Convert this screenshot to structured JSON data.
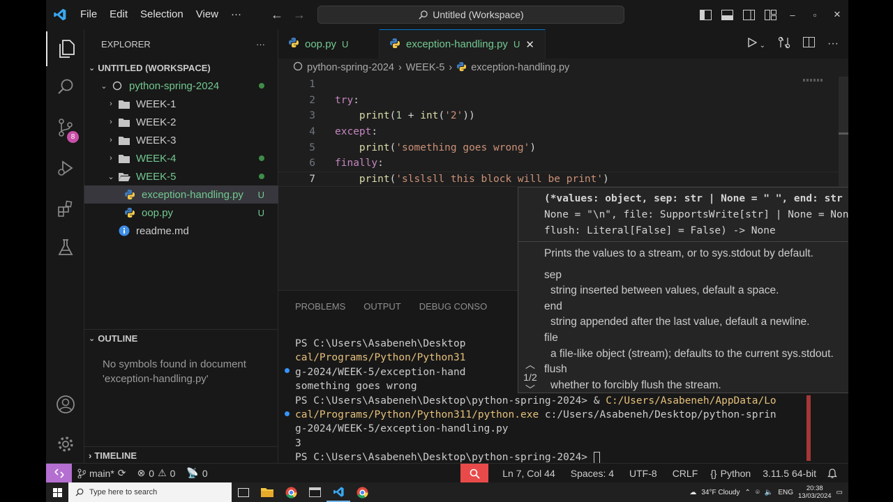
{
  "titlebar": {
    "menu": [
      "File",
      "Edit",
      "Selection",
      "View",
      "···"
    ],
    "command_center": "Untitled (Workspace)",
    "window_controls": {
      "minimize": "–",
      "restore": "▫",
      "close": "✕"
    }
  },
  "activity_badge": "8",
  "sidebar": {
    "title": "EXPLORER",
    "more": "···",
    "workspace_section": "UNTITLED (WORKSPACE)",
    "tree": [
      {
        "label": "python-spring-2024",
        "type": "root"
      },
      {
        "label": "WEEK-1",
        "type": "folder"
      },
      {
        "label": "WEEK-2",
        "type": "folder"
      },
      {
        "label": "WEEK-3",
        "type": "folder"
      },
      {
        "label": "WEEK-4",
        "type": "folder"
      },
      {
        "label": "WEEK-5",
        "type": "folder-open"
      },
      {
        "label": "exception-handling.py",
        "type": "py",
        "status": "U"
      },
      {
        "label": "oop.py",
        "type": "py",
        "status": "U"
      },
      {
        "label": "readme.md",
        "type": "md"
      }
    ],
    "outline_section": "OUTLINE",
    "outline_message": "No symbols found in document 'exception-handling.py'",
    "timeline_section": "TIMELINE"
  },
  "tabs": [
    {
      "label": "oop.py",
      "status": "U"
    },
    {
      "label": "exception-handling.py",
      "status": "U",
      "close": "✕"
    }
  ],
  "breadcrumb": [
    "python-spring-2024",
    "WEEK-5",
    "exception-handling.py"
  ],
  "editor": {
    "line_numbers": [
      "1",
      "2",
      "3",
      "4",
      "5",
      "6",
      "7"
    ],
    "lines": [
      [],
      [
        [
          "kw",
          "try"
        ],
        [
          "pl",
          ":"
        ]
      ],
      [
        [
          "pl",
          "    "
        ],
        [
          "fn",
          "print"
        ],
        [
          "pl",
          "("
        ],
        [
          "num",
          "1"
        ],
        [
          "pl",
          " + "
        ],
        [
          "fn",
          "int"
        ],
        [
          "pl",
          "("
        ],
        [
          "str",
          "'2'"
        ],
        [
          "pl",
          "))"
        ]
      ],
      [
        [
          "kw",
          "except"
        ],
        [
          "pl",
          ":"
        ]
      ],
      [
        [
          "pl",
          "    "
        ],
        [
          "fn",
          "print"
        ],
        [
          "pl",
          "("
        ],
        [
          "str",
          "'something goes wrong'"
        ],
        [
          "pl",
          ")"
        ]
      ],
      [
        [
          "kw",
          "finally"
        ],
        [
          "pl",
          ":"
        ]
      ],
      [
        [
          "pl",
          "    "
        ],
        [
          "fn",
          "print"
        ],
        [
          "pl",
          "("
        ],
        [
          "str",
          "'slslsll this block will be print'"
        ],
        [
          "pl",
          ")"
        ]
      ]
    ]
  },
  "hover": {
    "signature": [
      "(*values: object, sep: str | None = \" \", end: str |",
      "None = \"\\n\", file: SupportsWrite[str] | None = None,",
      "flush: Literal[False] = False) -> None"
    ],
    "description": "Prints the values to a stream, or to sys.stdout by default.",
    "params": [
      {
        "name": "sep",
        "desc": "string inserted between values, default a space."
      },
      {
        "name": "end",
        "desc": "string appended after the last value, default a newline."
      },
      {
        "name": "file",
        "desc": "a file-like object (stream); defaults to the current sys.stdout."
      },
      {
        "name": "flush",
        "desc": "whether to forcibly flush the stream."
      }
    ],
    "overload": "1/2"
  },
  "panel": {
    "tabs": [
      "PROBLEMS",
      "OUTPUT",
      "DEBUG CONSO"
    ],
    "terminal": {
      "l1": "PS C:\\Users\\Asabeneh\\Desktop",
      "l2": "cal/Programs/Python/Python31",
      "l3": "g-2024/WEEK-5/exception-hand",
      "l4": "something goes wrong",
      "l5_prompt": "PS C:\\Users\\Asabeneh\\Desktop\\python-spring-2024> & ",
      "l5_path": "C:/Users/Asabeneh/AppData/Lo",
      "l6_path": "cal/Programs/Python/Python311/python.exe",
      "l6_rest": " c:/Users/Asabeneh/Desktop/python-sprin",
      "l7": "g-2024/WEEK-5/exception-handling.py",
      "l8": "3",
      "l9_prompt": "PS C:\\Users\\Asabeneh\\Desktop\\python-spring-2024> "
    }
  },
  "statusbar": {
    "branch": "main*",
    "errors": "0",
    "warnings": "0",
    "ports": "0",
    "position": "Ln 7, Col 44",
    "spaces": "Spaces: 4",
    "encoding": "UTF-8",
    "eol": "CRLF",
    "language": "Python",
    "interpreter": "3.11.5 64-bit"
  },
  "taskbar": {
    "search_placeholder": "Type here to search",
    "weather": "34°F  Cloudy",
    "lang": "ENG",
    "time": "20:38",
    "date": "13/03/2024"
  },
  "colors": {
    "accent": "#0078d4",
    "git_untracked": "#73c991",
    "remote": "#b46fd1",
    "badge": "#c94fa8"
  }
}
